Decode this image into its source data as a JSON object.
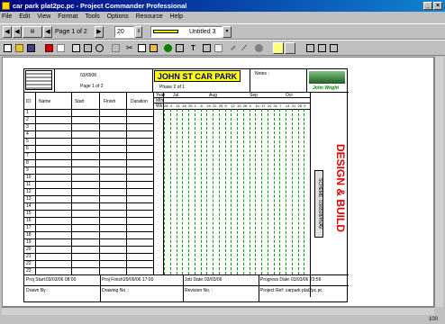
{
  "window": {
    "title": "car park plat2pc.pc - Project Commander Professional"
  },
  "menu": [
    "File",
    "Edit",
    "View",
    "Format",
    "Tools",
    "Options",
    "Resource",
    "Help"
  ],
  "toolbar1": {
    "page_label": "Page 1 of 2",
    "zoom": "20",
    "line_label": "Untitled 3"
  },
  "sheet": {
    "project_code": "03/6508",
    "page": "Page 1 of 2",
    "job_title": "JOHN ST CAR PARK",
    "phase": "Phase 2 of 1",
    "notes_label": "Notes :",
    "company": "John Wright",
    "col_headers": {
      "id": "ID",
      "name": "Name",
      "start": "Start",
      "finish": "Finish",
      "duration": "Duration"
    },
    "timescale": {
      "row1_label": "Year",
      "row2_label": "Mth",
      "row3_label": "Wk",
      "months": [
        "Jul",
        "Aug",
        "Sep",
        "Oct"
      ],
      "weeks": [
        "28",
        "4",
        "11",
        "18",
        "25",
        "1",
        "8",
        "15",
        "22",
        "29",
        "5",
        "12",
        "19",
        "26",
        "3",
        "10",
        "17",
        "24",
        "31",
        "7",
        "14",
        "21",
        "28",
        "5"
      ]
    },
    "rows": [
      "1",
      "2",
      "3",
      "4",
      "5",
      "6",
      "7",
      "8",
      "9",
      "10",
      "11",
      "12",
      "13",
      "14",
      "15",
      "16",
      "17",
      "18",
      "19",
      "20",
      "21",
      "22",
      "23"
    ],
    "scheme": "SCHEME: 03/6508/HVAV",
    "build": "DESIGN & BUILD",
    "footer": {
      "proj_start_label": "Proj Start:",
      "proj_start": "03/03/06 08:00",
      "proj_finish_label": "Proj Finish:",
      "proj_finish": "29/09/06 17:00",
      "job_date_label": "Job Date:",
      "job_date": "03/03/06",
      "print_date_label": "Progress Date:",
      "print_date": "03/03/06 23:59",
      "drawn_by": "Drawn By :",
      "drawing_no": "Drawing No. :",
      "revision_no": "Revision No. :",
      "project_ref_label": "Project Ref:",
      "project_ref": "carpark plat2pc.pc"
    }
  },
  "status": {
    "zoom": "100"
  }
}
